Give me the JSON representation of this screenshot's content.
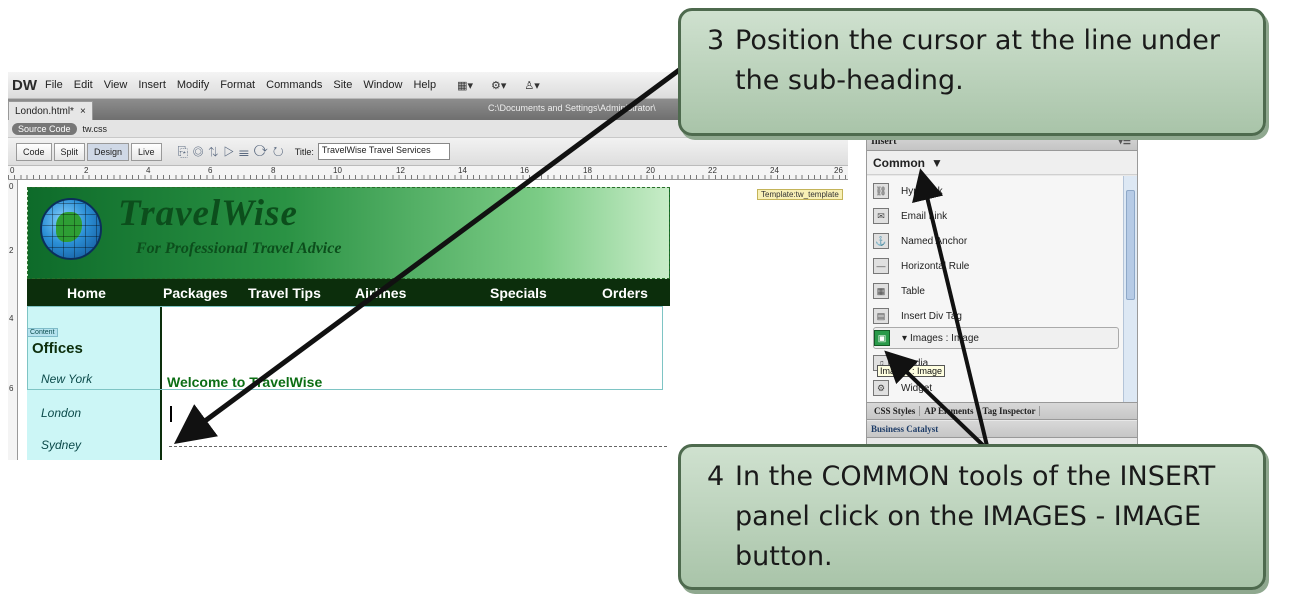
{
  "app": {
    "logo": "DW",
    "menus": [
      "File",
      "Edit",
      "View",
      "Insert",
      "Modify",
      "Format",
      "Commands",
      "Site",
      "Window",
      "Help"
    ]
  },
  "document": {
    "tab_label": "London.html*",
    "tab_close": "×",
    "path_fragment": "C:\\Documents and Settings\\Administrator\\",
    "source_code_label": "Source Code",
    "related_file": "tw.css"
  },
  "toolbar": {
    "views": [
      "Code",
      "Split",
      "Design",
      "Live"
    ],
    "active_view": "Design",
    "title_label": "Title:",
    "title_value": "TravelWise Travel Services"
  },
  "ruler": {
    "top_numbers": [
      "0",
      "2",
      "4",
      "6",
      "8",
      "10",
      "12",
      "14",
      "16",
      "18",
      "20",
      "22",
      "24",
      "26"
    ],
    "left_numbers": [
      "0",
      "2",
      "4",
      "6"
    ]
  },
  "page": {
    "brand": "TravelWise",
    "tagline": "For Professional Travel Advice",
    "nav": [
      "Home",
      "Packages",
      "Travel Tips",
      "Airlines",
      "Specials",
      "Orders"
    ],
    "template_tag": "Template:tw_template",
    "content_tag": "Content",
    "sidebar_title": "Offices",
    "cities": [
      "New York",
      "London",
      "Sydney"
    ],
    "welcome_heading": "Welcome to TravelWise"
  },
  "panels": {
    "insert_label": "Insert",
    "category": "Common",
    "items": [
      "Hyperlink",
      "Email Link",
      "Named Anchor",
      "Horizontal Rule",
      "Table",
      "Insert Div Tag",
      "Images : Image",
      "Media",
      "Widget"
    ],
    "tooltip": "Images : Image",
    "tabs": [
      "CSS Styles",
      "AP Elements",
      "Tag Inspector"
    ],
    "business_catalyst": "Business Catalyst"
  },
  "callouts": {
    "step3_number": "3",
    "step3_line1": "Position the cursor at the line under",
    "step3_line2": "the sub-heading.",
    "step4_number": "4",
    "step4_line1": "In the COMMON tools of the INSERT",
    "step4_line2": "panel click on the IMAGES - IMAGE",
    "step4_line3": "button."
  },
  "colors": {
    "callout_fill": "#bcd4bc",
    "callout_border": "#4e6a4e",
    "banner_green": "#0c4e1c",
    "nav_dark": "#0c2e0c",
    "sidebar_cyan": "#ccf6f6"
  }
}
